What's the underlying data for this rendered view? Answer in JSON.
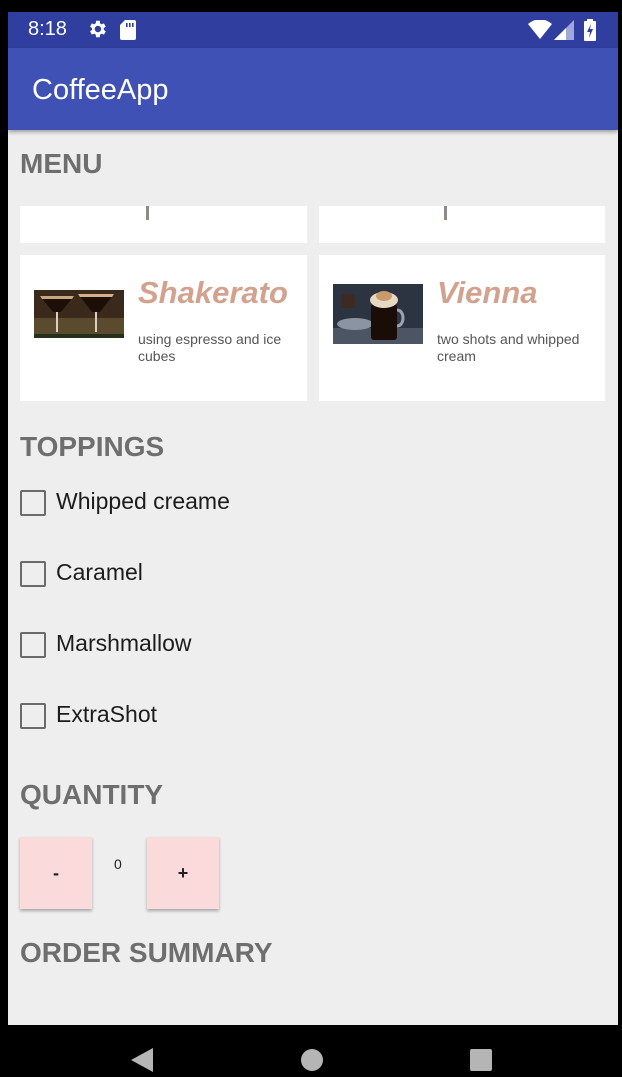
{
  "status_bar": {
    "time": "8:18",
    "icons": [
      "gear-icon",
      "sd-card-icon",
      "wifi-icon",
      "signal-icon",
      "battery-icon"
    ]
  },
  "app_bar": {
    "title": "CoffeeApp",
    "color": "#3f51b5"
  },
  "menu": {
    "title": "MENU",
    "items": [
      {
        "name": "Shakerato",
        "description": "using espresso and ice cubes"
      },
      {
        "name": "Vienna",
        "description": "two shots and whipped cream"
      }
    ]
  },
  "toppings": {
    "title": "TOPPINGS",
    "items": [
      {
        "label": "Whipped creame",
        "checked": false
      },
      {
        "label": "Caramel",
        "checked": false
      },
      {
        "label": "Marshmallow",
        "checked": false
      },
      {
        "label": "ExtraShot",
        "checked": false
      }
    ]
  },
  "quantity": {
    "title": "QUANTITY",
    "decrement_label": "-",
    "value": "0",
    "increment_label": "+"
  },
  "order_summary": {
    "title": "ORDER SUMMARY"
  },
  "nav_bar": {
    "icons": [
      "back-icon",
      "home-icon",
      "recents-icon"
    ]
  },
  "colors": {
    "accent_title": "#d3a28e",
    "button_bg": "#fadada",
    "status_bar": "#303f9f"
  }
}
